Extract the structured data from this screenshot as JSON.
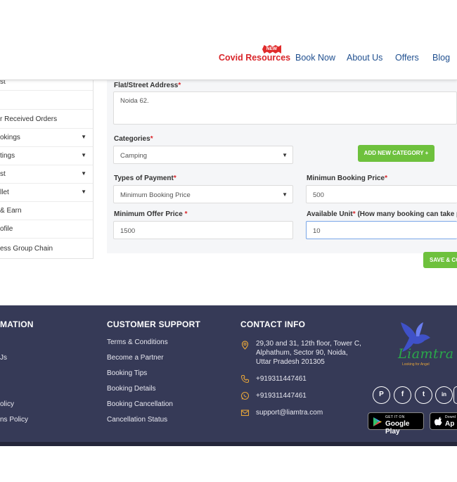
{
  "header": {
    "nav": {
      "covid": "Covid Resources",
      "new_badge": "NEW",
      "book_now": "Book Now",
      "about_us": "About Us",
      "offers": "Offers",
      "blog": "Blog"
    }
  },
  "sidebar": {
    "items": [
      {
        "label": "st",
        "chevron": false
      },
      {
        "label": "",
        "chevron": false
      },
      {
        "label": "r Received Orders",
        "chevron": false
      },
      {
        "label": "okings",
        "chevron": true
      },
      {
        "label": "tings",
        "chevron": true
      },
      {
        "label": "st",
        "chevron": true
      },
      {
        "label": "llet",
        "chevron": true
      },
      {
        "label": "& Earn",
        "chevron": false
      },
      {
        "label": "ofile",
        "chevron": false
      },
      {
        "label": "ess Group Chain",
        "chevron": false
      }
    ]
  },
  "form": {
    "address_label": "Flat/Street Address",
    "address_value": "Noida 62.",
    "categories_label": "Categories",
    "categories_value": "Camping",
    "add_category_button": "ADD NEW CATEGORY +",
    "payment_label": "Types of Payment",
    "payment_value": "Minimum Booking Price",
    "min_booking_label": "Minimun Booking Price",
    "min_booking_value": "500",
    "min_offer_label": "Minimum Offer Price ",
    "min_offer_value": "1500",
    "available_unit_label": "Available Unit",
    "available_unit_hint": " (How many booking can take pe",
    "available_unit_value": "10",
    "save_button": "SAVE & CO",
    "required_mark": "*"
  },
  "footer": {
    "information_title": "MATION",
    "information_links": [
      "Js",
      "olicy",
      "ns Policy"
    ],
    "support_title": "CUSTOMER SUPPORT",
    "support_links": [
      "Terms & Conditions",
      "Become a Partner",
      "Booking Tips",
      "Booking Details",
      "Booking Cancellation",
      "Cancellation Status"
    ],
    "contact_title": "CONTACT INFO",
    "address_lines": [
      "29,30 and 31, 12th floor, Tower C,",
      "Alphathum, Sector 90, Noida,",
      "Uttar Pradesh 201305"
    ],
    "phone1": "+919311447461",
    "whatsapp": "+919311447461",
    "email": "support@liamtra.com",
    "logo_text": "Liamtra",
    "logo_tagline": "Looking for Angel",
    "social_icons": [
      "pinterest-icon",
      "facebook-icon",
      "twitter-icon",
      "linkedin-icon"
    ],
    "google_play_small": "GET IT ON",
    "google_play_big": "Google Play",
    "app_store_small": "Downl",
    "app_store_big": "Ap"
  },
  "colors": {
    "accent_red": "#d9252a",
    "nav_blue": "#1f4f8f",
    "button_green": "#6ec13d",
    "footer_bg": "#363a57",
    "contact_icon": "#e5a43a"
  }
}
